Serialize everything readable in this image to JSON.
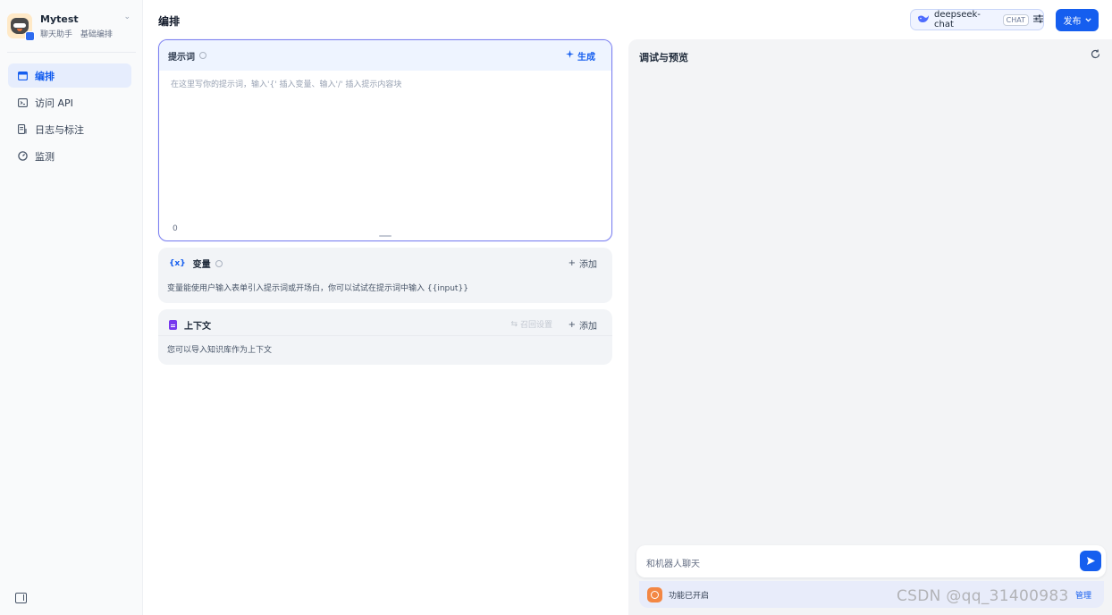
{
  "app": {
    "name": "Mytest",
    "tag_type": "聊天助手",
    "tag_mode": "基础编排"
  },
  "sidebar": {
    "items": [
      {
        "label": "编排",
        "icon": "layout-icon",
        "active": true
      },
      {
        "label": "访问 API",
        "icon": "terminal-icon",
        "active": false
      },
      {
        "label": "日志与标注",
        "icon": "log-icon",
        "active": false
      },
      {
        "label": "监测",
        "icon": "gauge-icon",
        "active": false
      }
    ]
  },
  "header": {
    "title": "编排",
    "model_name": "deepseek-chat",
    "model_mode": "CHAT",
    "publish_label": "发布"
  },
  "prompt": {
    "label": "提示词",
    "generate_label": "生成",
    "placeholder": "在这里写你的提示词，输入'{' 插入变量、输入'/' 插入提示内容块",
    "char_count": "0"
  },
  "variables": {
    "icon_text": "{x}",
    "title": "变量",
    "add_label": "添加",
    "description": "变量能使用户输入表单引入提示词或开场白，你可以试试在提示词中输入 {{input}}"
  },
  "context": {
    "title": "上下文",
    "recall_label": "召回设置",
    "add_label": "添加",
    "description": "您可以导入知识库作为上下文"
  },
  "debug": {
    "title": "调试与预览",
    "chat_placeholder": "和机器人聊天",
    "feature_text": "功能已开启",
    "manage_label": "管理"
  },
  "watermark": "CSDN @qq_31400983",
  "colors": {
    "accent": "#155eef",
    "prompt_border": "#7a7ff0",
    "context_icon": "#7839ee",
    "feature_icon": "#f38744"
  }
}
